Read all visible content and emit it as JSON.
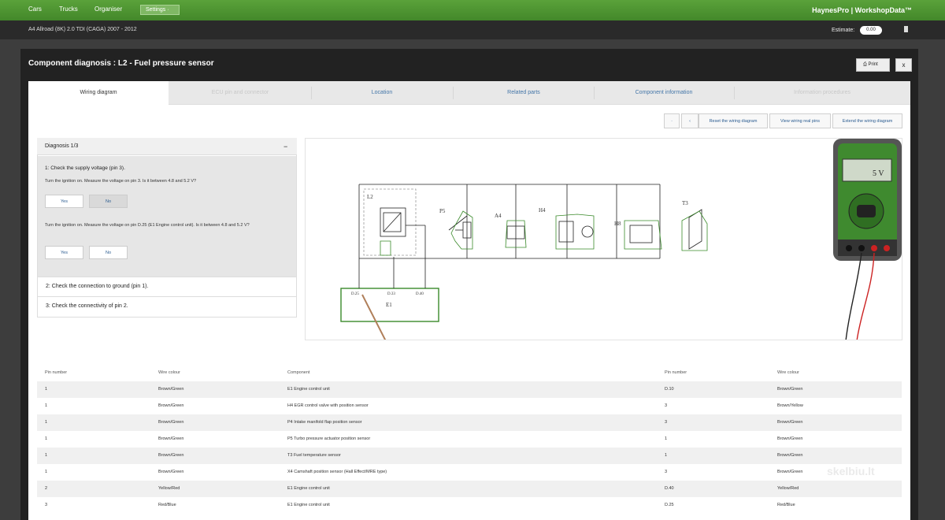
{
  "nav": {
    "tabs": [
      "Cars",
      "Trucks",
      "Organiser"
    ],
    "settings": "Settings ·",
    "brand": "HaynesPro | WorkshopData™"
  },
  "vehicle": "A4 Allroad (8K) 2.0 TDI (CAGA) 2007 - 2012",
  "estimate": {
    "label": "Estimate:",
    "value": "0.00"
  },
  "panel": {
    "title": "Component diagnosis : L2 - Fuel pressure sensor",
    "print": "Print",
    "close": "x"
  },
  "tabs": [
    {
      "label": "Wiring diagram",
      "state": "active"
    },
    {
      "label": "ECU pin and connector",
      "state": "disabled"
    },
    {
      "label": "Location",
      "state": "normal"
    },
    {
      "label": "Related parts",
      "state": "normal"
    },
    {
      "label": "Component information",
      "state": "normal"
    },
    {
      "label": "Information procedures",
      "state": "disabled"
    }
  ],
  "toolbar": {
    "b1": "·",
    "b2": "‹",
    "b3": "Reset the wiring diagram",
    "b4": "View wiring real pins",
    "b5": "Extend the wiring diagram"
  },
  "diagnosis": {
    "header": "Diagnosis 1/3",
    "collapse": "−",
    "step1_title": "1: Check the supply voltage (pin 3).",
    "q1": "Turn the ignition on. Measure the voltage on pin 3. Is it between 4.8 and 5.2 V?",
    "q2": "Turn the ignition on. Measure the voltage on pin D.25 (E1 Engine control unit). Is it between 4.8 and 5.2 V?",
    "yes": "Yes",
    "no": "No",
    "step2": "2: Check the connection to ground (pin 1).",
    "step3": "3: Check the connectivity of pin 2."
  },
  "diagram": {
    "labels": [
      "L2",
      "P5",
      "A4",
      "H4",
      "H8",
      "T3",
      "E1",
      "D.25",
      "D.33",
      "D.40"
    ],
    "meter_display": "5 V"
  },
  "table": {
    "headers": [
      "Pin number",
      "Wire colour",
      "Component",
      "Pin number",
      "Wire colour"
    ],
    "rows": [
      [
        "1",
        "Brown/Green",
        "E1 Engine control unit",
        "D.10",
        "Brown/Green"
      ],
      [
        "1",
        "Brown/Green",
        "H4 EGR control valve with position sensor",
        "3",
        "Brown/Yellow"
      ],
      [
        "1",
        "Brown/Green",
        "P4 Intake manifold flap position sensor",
        "3",
        "Brown/Green"
      ],
      [
        "1",
        "Brown/Green",
        "P5 Turbo pressure actuator position sensor",
        "1",
        "Brown/Green"
      ],
      [
        "1",
        "Brown/Green",
        "T3 Fuel temperature sensor",
        "1",
        "Brown/Green"
      ],
      [
        "1",
        "Brown/Green",
        "X4 Camshaft position sensor (Hall Effect/MRE type)",
        "3",
        "Brown/Green"
      ],
      [
        "2",
        "Yellow/Red",
        "E1 Engine control unit",
        "D.40",
        "Yellow/Red"
      ],
      [
        "3",
        "Red/Blue",
        "E1 Engine control unit",
        "D.25",
        "Red/Blue"
      ]
    ]
  },
  "watermark": "skelbiu.lt",
  "colors": {
    "brand_green": "#4d962f",
    "link_blue": "#4476a8",
    "wire_green": "#3a8a2a",
    "meter_green": "#3f8a2f"
  }
}
